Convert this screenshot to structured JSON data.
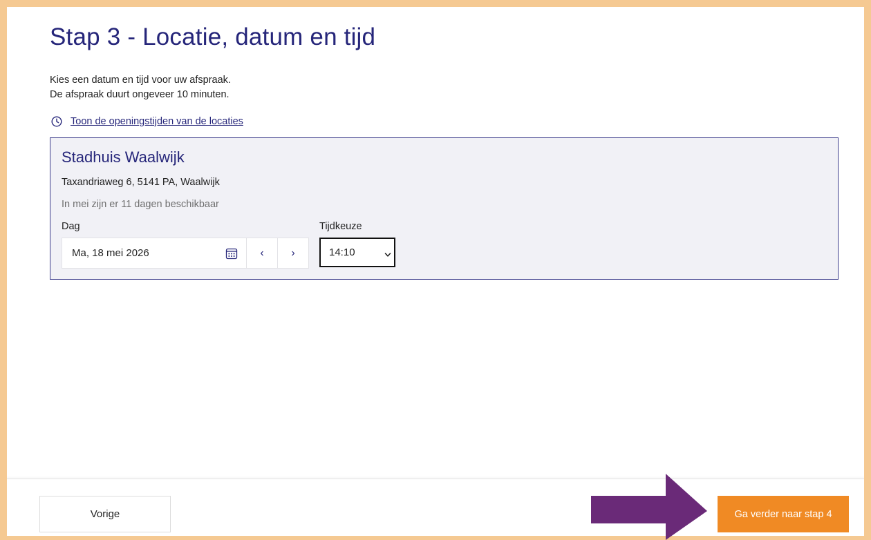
{
  "page": {
    "title": "Stap 3 - Locatie, datum en tijd",
    "intro_line1": "Kies een datum en tijd voor uw afspraak.",
    "intro_line2": "De afspraak duurt ongeveer 10 minuten.",
    "hours_link": "Toon de openingstijden van de locaties"
  },
  "location": {
    "name": "Stadhuis Waalwijk",
    "address": "Taxandriaweg 6, 5141 PA, Waalwijk",
    "availability": "In mei zijn er 11 dagen beschikbaar",
    "day_label": "Dag",
    "time_label": "Tijdkeuze",
    "date_value": "Ma, 18 mei 2026",
    "prev_symbol": "‹",
    "next_symbol": "›",
    "time_value": "14:10"
  },
  "footer": {
    "prev_label": "Vorige",
    "next_label": "Ga verder naar stap 4"
  },
  "colors": {
    "frame": "#f5c992",
    "title": "#26267a",
    "accent_button": "#f08a24",
    "arrow": "#6a2a78",
    "card_bg": "#f1f1f6"
  },
  "icons": [
    "clock-icon",
    "calendar-icon",
    "chevron-left-icon",
    "chevron-right-icon",
    "chevron-down-icon",
    "arrow-right-icon"
  ]
}
